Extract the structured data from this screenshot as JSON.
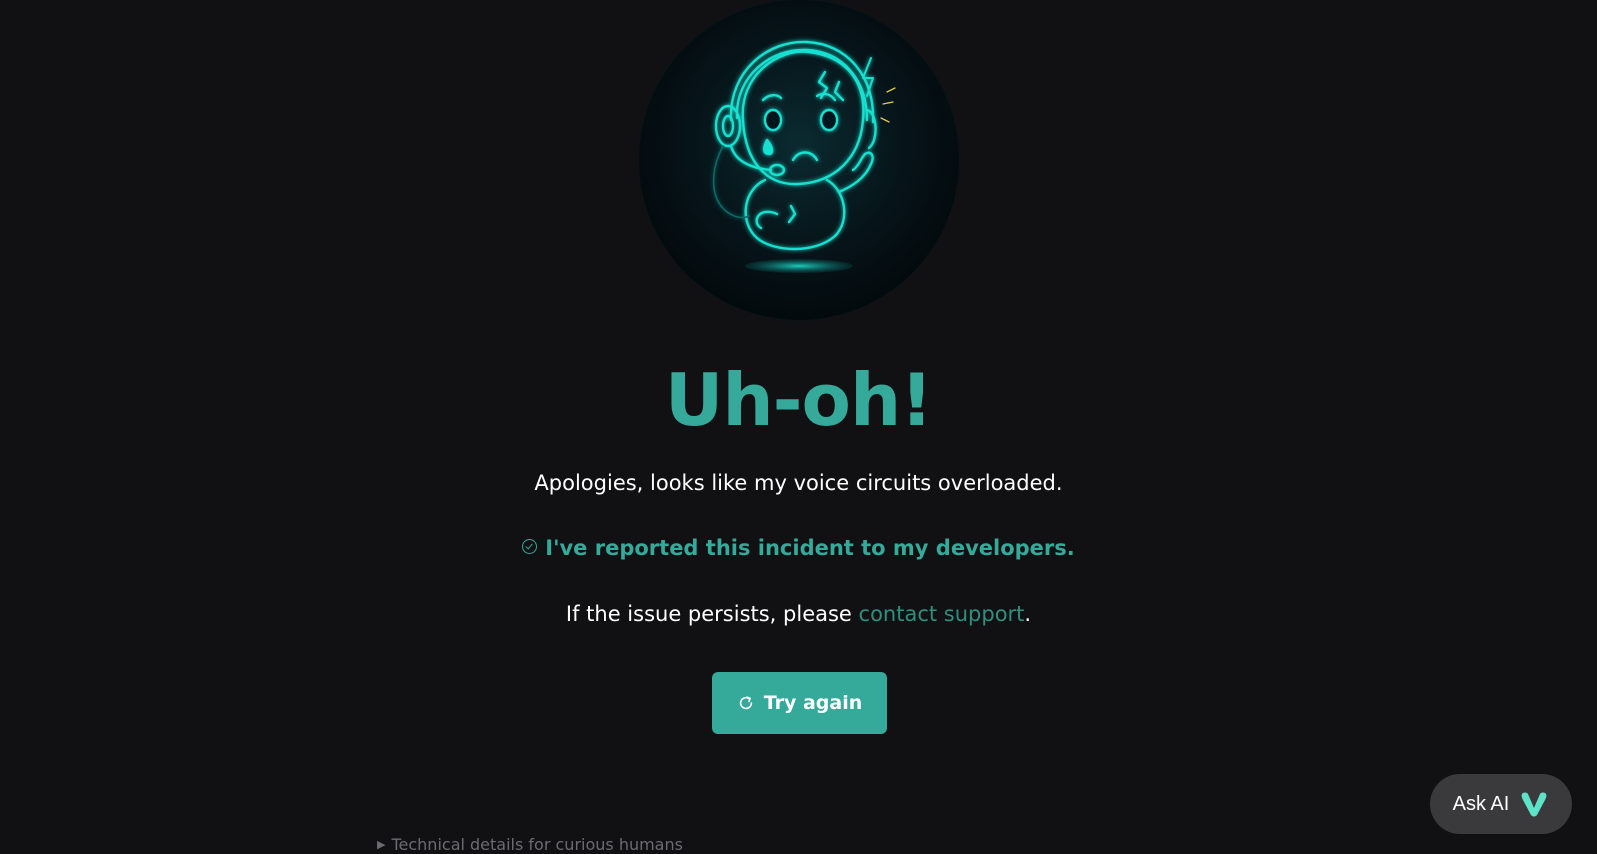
{
  "error": {
    "title": "Uh-oh!",
    "subtitle": "Apologies, looks like my voice circuits overloaded.",
    "reported": "I've reported this incident to my developers.",
    "persist_prefix": "If the issue persists, please ",
    "persist_link": "contact support",
    "persist_suffix": ".",
    "try_again_label": "Try again",
    "details_label": "Technical details for curious humans",
    "details_arrow": "▶"
  },
  "assistant": {
    "ask_ai_label": "Ask AI"
  },
  "colors": {
    "background": "#111113",
    "accent": "#35a99a",
    "link": "#2e8f7e",
    "mascot_glow": "#19e0d0",
    "ask_ai_bg": "#3a3a3c",
    "ask_ai_logo": "#5ee3c8"
  },
  "icons": {
    "mascot": "sad-robot-headset-illustration",
    "reported": "check-circle-icon",
    "try_again": "refresh-icon",
    "ask_ai_logo": "v-logo-icon",
    "details": "triangle-right-icon"
  }
}
